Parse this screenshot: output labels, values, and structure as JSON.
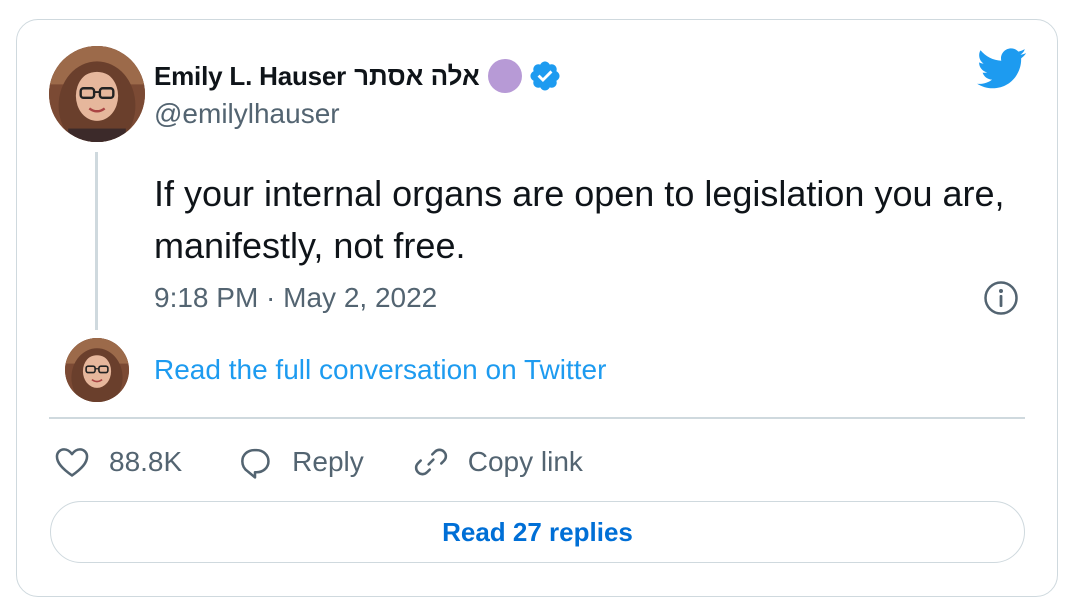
{
  "author": {
    "display_name": "Emily L. Hauser",
    "hebrew_name": "אלה אסתר",
    "handle": "@emilylhauser",
    "verified": true,
    "badge_color": "#b79ad6"
  },
  "tweet": {
    "text": "If your internal organs are open to legislation you are, manifestly, not free.",
    "timestamp": "9:18 PM · May 2, 2022"
  },
  "conversation_link": "Read the full conversation on Twitter",
  "actions": {
    "like_count": "88.8K",
    "reply_label": "Reply",
    "copy_label": "Copy link"
  },
  "replies_button": "Read 27 replies",
  "icons": {
    "brand": "twitter-bird-icon",
    "verified": "verified-badge-icon",
    "info": "info-icon",
    "like": "heart-icon",
    "reply": "speech-bubble-icon",
    "copy": "link-icon"
  },
  "colors": {
    "accent": "#1d9bf0",
    "button_text": "#006fd6",
    "secondary_text": "#536471",
    "border": "#cfd9de"
  }
}
